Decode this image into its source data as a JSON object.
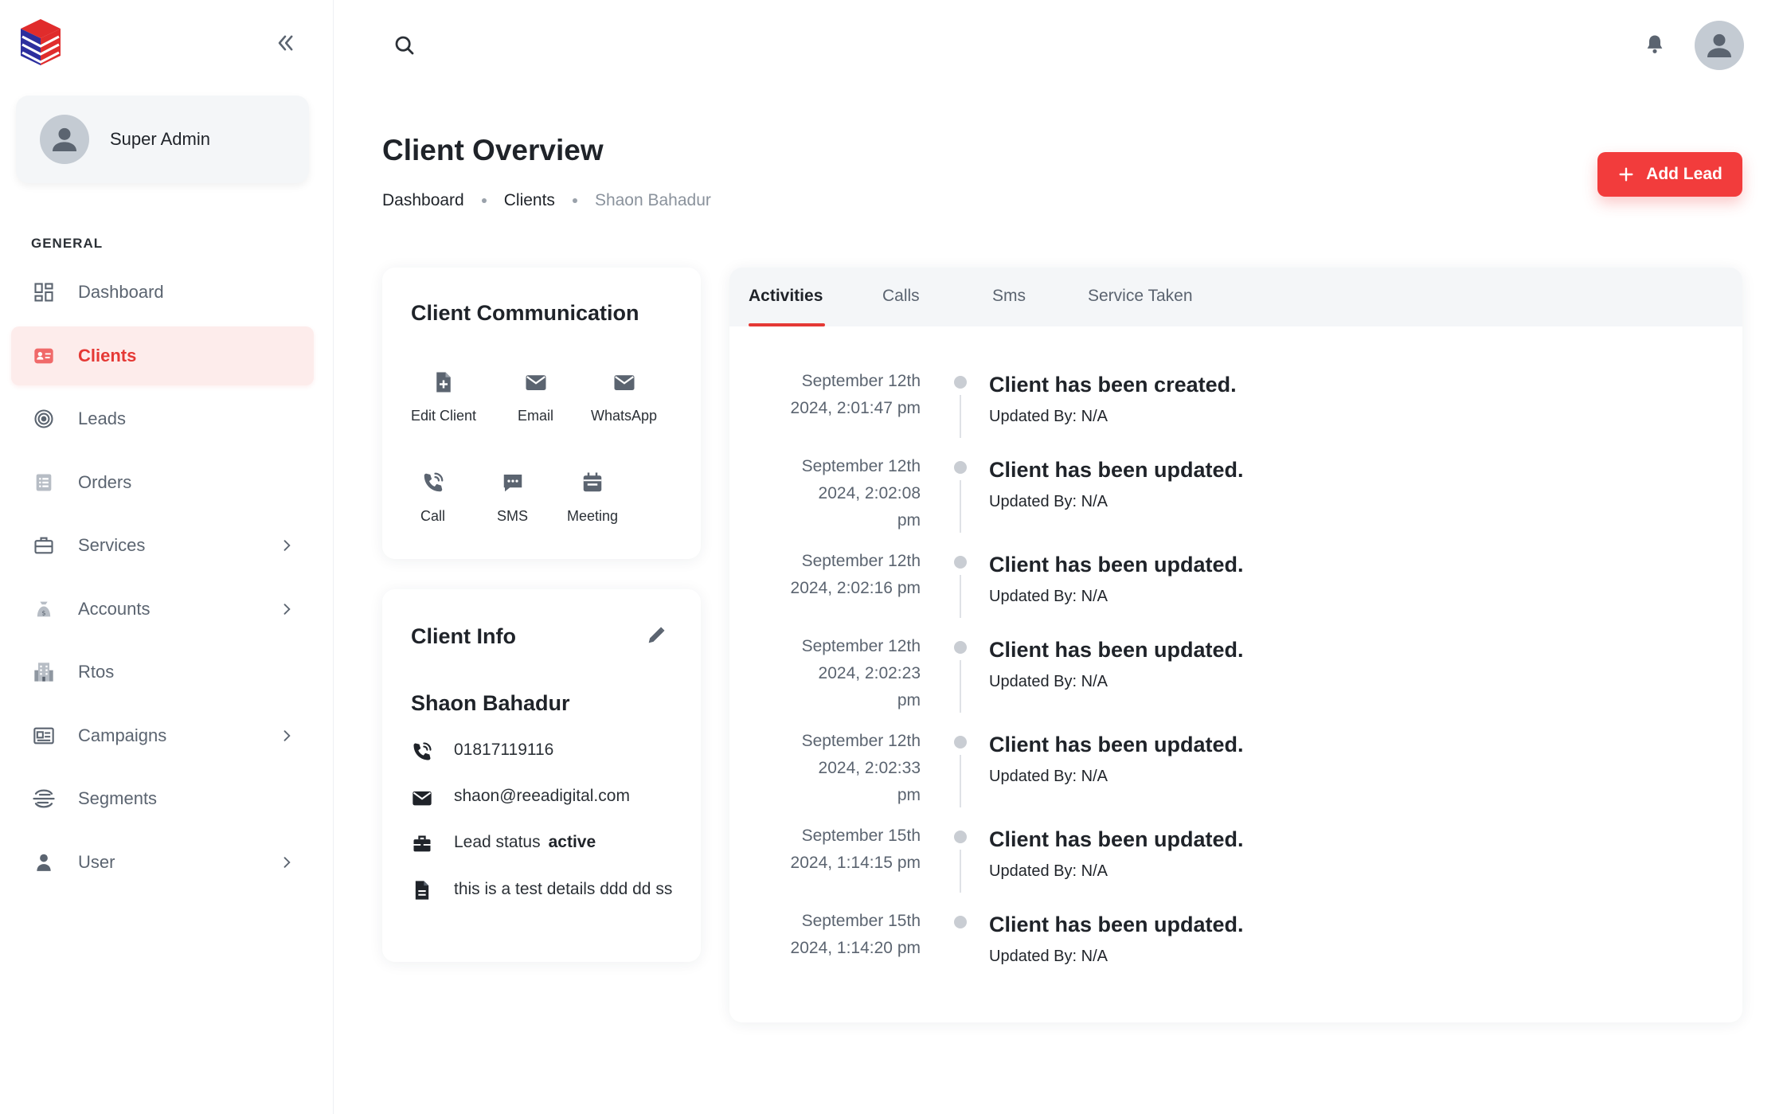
{
  "sidebar": {
    "user_name": "Super Admin",
    "section_label": "GENERAL",
    "items": [
      {
        "label": "Dashboard",
        "icon": "dashboard-icon",
        "active": false,
        "has_chevron": false
      },
      {
        "label": "Clients",
        "icon": "contact-card-icon",
        "active": true,
        "has_chevron": false
      },
      {
        "label": "Leads",
        "icon": "target-icon",
        "active": false,
        "has_chevron": false
      },
      {
        "label": "Orders",
        "icon": "list-icon",
        "active": false,
        "has_chevron": false
      },
      {
        "label": "Services",
        "icon": "briefcase-icon",
        "active": false,
        "has_chevron": true
      },
      {
        "label": "Accounts",
        "icon": "money-bag-icon",
        "active": false,
        "has_chevron": true
      },
      {
        "label": "Rtos",
        "icon": "building-icon",
        "active": false,
        "has_chevron": false
      },
      {
        "label": "Campaigns",
        "icon": "newspaper-icon",
        "active": false,
        "has_chevron": true
      },
      {
        "label": "Segments",
        "icon": "segments-icon",
        "active": false,
        "has_chevron": false
      },
      {
        "label": "User",
        "icon": "user-icon",
        "active": false,
        "has_chevron": true
      }
    ]
  },
  "header": {
    "title": "Client Overview",
    "breadcrumb": [
      "Dashboard",
      "Clients",
      "Shaon Bahadur"
    ],
    "add_lead_label": "Add Lead"
  },
  "communication": {
    "title": "Client Communication",
    "actions": [
      "Edit Client",
      "Email",
      "WhatsApp",
      "Call",
      "SMS",
      "Meeting"
    ]
  },
  "client_info": {
    "title": "Client Info",
    "name": "Shaon Bahadur",
    "phone": "01817119116",
    "email": "shaon@reeadigital.com",
    "lead_status_label": "Lead status",
    "lead_status_value": "active",
    "details": "this is a test details ddd dd ss"
  },
  "activity": {
    "tabs": [
      "Activities",
      "Calls",
      "Sms",
      "Service Taken"
    ],
    "active_tab": "Activities",
    "entries": [
      {
        "date_line1": "September 12th",
        "date_line2": "2024, 2:01:47 pm",
        "date_line3": "",
        "title": "Client has been created.",
        "sub": "Updated By: N/A"
      },
      {
        "date_line1": "September 12th",
        "date_line2": "2024, 2:02:08",
        "date_line3": "pm",
        "title": "Client has been updated.",
        "sub": "Updated By: N/A"
      },
      {
        "date_line1": "September 12th",
        "date_line2": "2024, 2:02:16 pm",
        "date_line3": "",
        "title": "Client has been updated.",
        "sub": "Updated By: N/A"
      },
      {
        "date_line1": "September 12th",
        "date_line2": "2024, 2:02:23",
        "date_line3": "pm",
        "title": "Client has been updated.",
        "sub": "Updated By: N/A"
      },
      {
        "date_line1": "September 12th",
        "date_line2": "2024, 2:02:33",
        "date_line3": "pm",
        "title": "Client has been updated.",
        "sub": "Updated By: N/A"
      },
      {
        "date_line1": "September 15th",
        "date_line2": "2024, 1:14:15 pm",
        "date_line3": "",
        "title": "Client has been updated.",
        "sub": "Updated By: N/A"
      },
      {
        "date_line1": "September 15th",
        "date_line2": "2024, 1:14:20 pm",
        "date_line3": "",
        "title": "Client has been updated.",
        "sub": "Updated By: N/A"
      }
    ]
  },
  "colors": {
    "accent": "#e53935",
    "button": "#f23c3c",
    "active_bg": "#fdeceb"
  }
}
